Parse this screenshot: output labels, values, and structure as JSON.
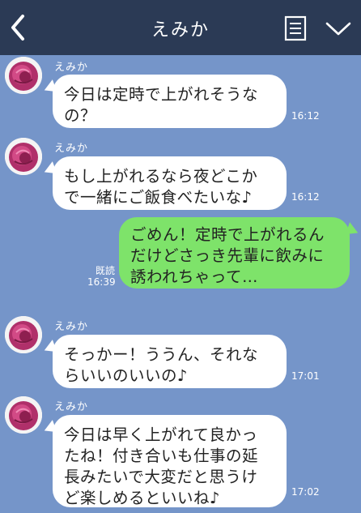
{
  "header": {
    "title": "えみか",
    "back_icon": "chevron-left-icon",
    "menu_icon": "notes-menu-icon",
    "dropdown_icon": "chevron-down-icon",
    "bg_color": "#2b3a55"
  },
  "chat_bg_color": "#7595c9",
  "outgoing_bubble_color": "#7ee36a",
  "messages": [
    {
      "direction": "in",
      "sender": "えみか",
      "text": "今日は定時で上がれそうな\nの？",
      "time": "16:12"
    },
    {
      "direction": "in",
      "sender": "えみか",
      "text": "もし上がれるなら夜どこか\nで一緒にご飯食べたいな♪",
      "time": "16:12"
    },
    {
      "direction": "out",
      "text": "ごめん！定時で上がれるん\nだけどさっき先輩に飲みに\n誘われちゃって…",
      "read": "既読",
      "time": "16:39"
    },
    {
      "direction": "in",
      "sender": "えみか",
      "text": "そっかー！ううん、それな\nらいいのいいの♪",
      "time": "17:01"
    },
    {
      "direction": "in",
      "sender": "えみか",
      "text": "今日は早く上がれて良かっ\nたね！付き合いも仕事の延\n長みたいで大変だと思うけ\nど楽しめるといいね♪",
      "time": "17:02"
    }
  ]
}
